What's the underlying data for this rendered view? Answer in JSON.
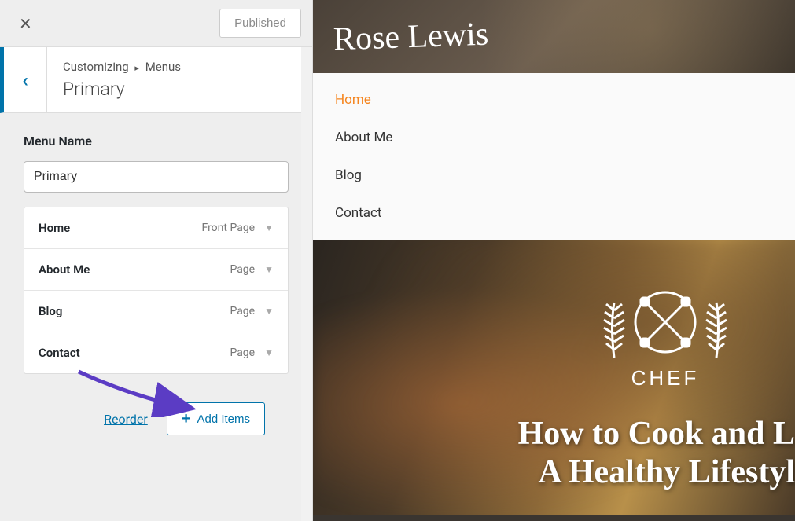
{
  "sidebar": {
    "published_label": "Published",
    "breadcrumb_prefix": "Customizing",
    "breadcrumb_current": "Menus",
    "section_title": "Primary",
    "menu_name_label": "Menu Name",
    "menu_name_value": "Primary",
    "menu_items": [
      {
        "label": "Home",
        "type": "Front Page"
      },
      {
        "label": "About Me",
        "type": "Page"
      },
      {
        "label": "Blog",
        "type": "Page"
      },
      {
        "label": "Contact",
        "type": "Page"
      }
    ],
    "reorder_label": "Reorder",
    "add_items_label": "Add Items"
  },
  "preview": {
    "site_title": "Rose Lewis",
    "nav": [
      {
        "label": "Home",
        "active": true
      },
      {
        "label": "About Me",
        "active": false
      },
      {
        "label": "Blog",
        "active": false
      },
      {
        "label": "Contact",
        "active": false
      }
    ],
    "chef_badge_text": "CHEF",
    "hero_line1": "How to Cook and L",
    "hero_line2": "A Healthy Lifestyl"
  }
}
